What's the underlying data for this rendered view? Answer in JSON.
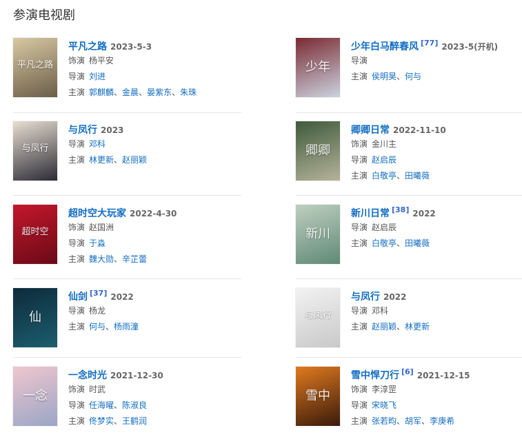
{
  "section_title": "参演电视剧",
  "shows": [
    {
      "name": "平凡之路",
      "date": "2023-5-3",
      "poster": "平凡之路",
      "color1": "#d8c9a3",
      "color2": "#6b5d48",
      "rows": [
        {
          "label": "饰演",
          "people": [
            "杨平安"
          ],
          "linked": false
        },
        {
          "label": "导演",
          "people": [
            "刘进"
          ],
          "linked": true
        },
        {
          "label": "主演",
          "people": [
            "郭麒麟",
            "金晨",
            "晏紫东",
            "朱珠"
          ],
          "linked": true
        }
      ]
    },
    {
      "name": "少年白马醉春风",
      "sup": "[77]",
      "date": "2023-5(开机)",
      "poster": "少年",
      "color1": "#7a2a32",
      "color2": "#cbd3e0",
      "rows": [
        {
          "label": "导演",
          "people": [],
          "linked": false
        },
        {
          "label": "主演",
          "people": [
            "侯明昊",
            "何与"
          ],
          "linked": true
        }
      ]
    },
    {
      "name": "与凤行",
      "date": "2023",
      "poster": "与凤行",
      "color1": "#e8ded2",
      "color2": "#2b2b35",
      "rows": [
        {
          "label": "导演",
          "people": [
            "邓科"
          ],
          "linked": true
        },
        {
          "label": "主演",
          "people": [
            "林更新",
            "赵丽颖"
          ],
          "linked": true
        }
      ]
    },
    {
      "name": "卿卿日常",
      "date": "2022-11-10",
      "poster": "卿卿",
      "color1": "#3e5a3a",
      "color2": "#b5b39a",
      "rows": [
        {
          "label": "饰演",
          "people": [
            "金川主"
          ],
          "linked": false
        },
        {
          "label": "导演",
          "people": [
            "赵启辰"
          ],
          "linked": true
        },
        {
          "label": "主演",
          "people": [
            "白敬亭",
            "田曦薇"
          ],
          "linked": true
        }
      ]
    },
    {
      "name": "超时空大玩家",
      "date": "2022-4-30",
      "poster": "超时空",
      "color1": "#c4172c",
      "color2": "#6a0a16",
      "rows": [
        {
          "label": "饰演",
          "people": [
            "赵国洲"
          ],
          "linked": false
        },
        {
          "label": "导演",
          "people": [
            "于淼"
          ],
          "linked": true
        },
        {
          "label": "主演",
          "people": [
            "魏大勋",
            "辛芷蕾"
          ],
          "linked": true
        }
      ]
    },
    {
      "name": "新川日常",
      "sup": "[38]",
      "date": "2022",
      "poster": "新川",
      "color1": "#bfcfbf",
      "color2": "#5f8a76",
      "rows": [
        {
          "label": "导演",
          "people": [
            "赵启辰"
          ],
          "linked": false
        },
        {
          "label": "主演",
          "people": [
            "白敬亭",
            "田曦薇"
          ],
          "linked": true
        }
      ]
    },
    {
      "name": "仙剑",
      "sup": "[37]",
      "date": "2022",
      "poster": "仙",
      "color1": "#0d2b3b",
      "color2": "#1c5e6e",
      "rows": [
        {
          "label": "导演",
          "people": [
            "杨龙"
          ],
          "linked": false
        },
        {
          "label": "主演",
          "people": [
            "何与",
            "杨雨潼"
          ],
          "linked": true
        }
      ]
    },
    {
      "name": "与凤行",
      "date": "2022",
      "poster": "与凤行",
      "color1": "#f2f2f2",
      "color2": "#c9c9c9",
      "rows": [
        {
          "label": "导演",
          "people": [
            "邓科"
          ],
          "linked": false
        },
        {
          "label": "主演",
          "people": [
            "赵丽颖",
            "林更新"
          ],
          "linked": true
        }
      ]
    },
    {
      "name": "一念时光",
      "date": "2021-12-30",
      "poster": "一念",
      "color1": "#f0c6cf",
      "color2": "#9aa6c6",
      "rows": [
        {
          "label": "饰演",
          "people": [
            "时武"
          ],
          "linked": false
        },
        {
          "label": "导演",
          "people": [
            "任海曜",
            "陈淑良"
          ],
          "linked": true
        },
        {
          "label": "主演",
          "people": [
            "佟梦实",
            "王鹤润"
          ],
          "linked": true
        }
      ]
    },
    {
      "name": "雪中悍刀行",
      "sup": "[6]",
      "date": "2021-12-15",
      "poster": "雪中",
      "color1": "#e07a1f",
      "color2": "#3a1a0a",
      "rows": [
        {
          "label": "饰演",
          "people": [
            "李淳罡"
          ],
          "linked": false
        },
        {
          "label": "导演",
          "people": [
            "宋晓飞"
          ],
          "linked": true
        },
        {
          "label": "主演",
          "people": [
            "张若昀",
            "胡军",
            "李庚希"
          ],
          "linked": true
        }
      ]
    }
  ]
}
